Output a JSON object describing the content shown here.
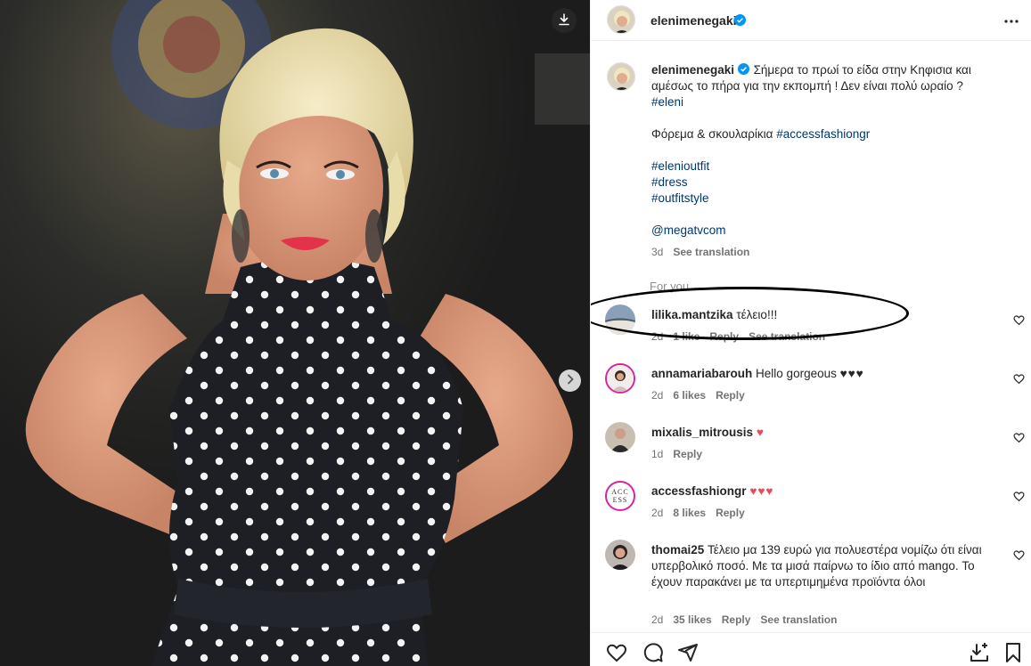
{
  "post": {
    "username": "elenimenegaki",
    "verified": true,
    "caption": {
      "text1": "Σήμερα το πρωί το είδα στην Κηφισια και αμέσως το πήρα για την εκπομπή ! Δεν είναι πολύ ωραίο ?",
      "tag_eleni": "#eleni",
      "text2": "Φόρεμα & σκουλαρίκια",
      "tag_access": "#accessfashiongr",
      "tags": [
        "#elenioutfit",
        "#dress",
        "#outfitstyle"
      ],
      "mention": "@megatvcom",
      "age": "3d",
      "see_translation": "See translation"
    },
    "for_you": "For you ⌄"
  },
  "comments": [
    {
      "user": "lilika.mantzika",
      "text": "τέλειο!!!",
      "age": "2d",
      "likes": "1 like",
      "reply": "Reply",
      "translation": "See translation"
    },
    {
      "user": "annamariabarouh",
      "text": "Hello gorgeous",
      "emoji": "♥♥♥",
      "age": "2d",
      "likes": "6 likes",
      "reply": "Reply"
    },
    {
      "user": "mixalis_mitrousis",
      "text": "",
      "emoji": "♥",
      "age": "1d",
      "reply": "Reply"
    },
    {
      "user": "accessfashiongr",
      "text": "",
      "emoji": "♥♥♥",
      "age": "2d",
      "likes": "8 likes",
      "reply": "Reply",
      "avatar_text": [
        "ACC",
        "ESS"
      ]
    },
    {
      "user": "thomai25",
      "text": "Τέλειο μα 139 ευρώ για πολυεστέρα νομίζω ότι είναι υπερβολικό ποσό. Με τα μισά παίρνω το ίδιο από mango. Το έχουν παρακάνει με τα υπερτιμημένα προϊόντα όλοι",
      "age": "2d",
      "likes": "35 likes",
      "reply": "Reply",
      "translation": "See translation"
    }
  ],
  "icons": {
    "download": "download-icon",
    "next": "chevron-right-icon",
    "more": "more-icon",
    "like": "heart-outline-icon",
    "comment": "comment-icon",
    "share": "share-icon",
    "save": "bookmark-icon",
    "saveto": "save-to-collection-icon"
  },
  "colors": {
    "link": "#00376b",
    "verified": "#0095f6",
    "heart_red": "#ed4956",
    "meta": "#737373"
  }
}
